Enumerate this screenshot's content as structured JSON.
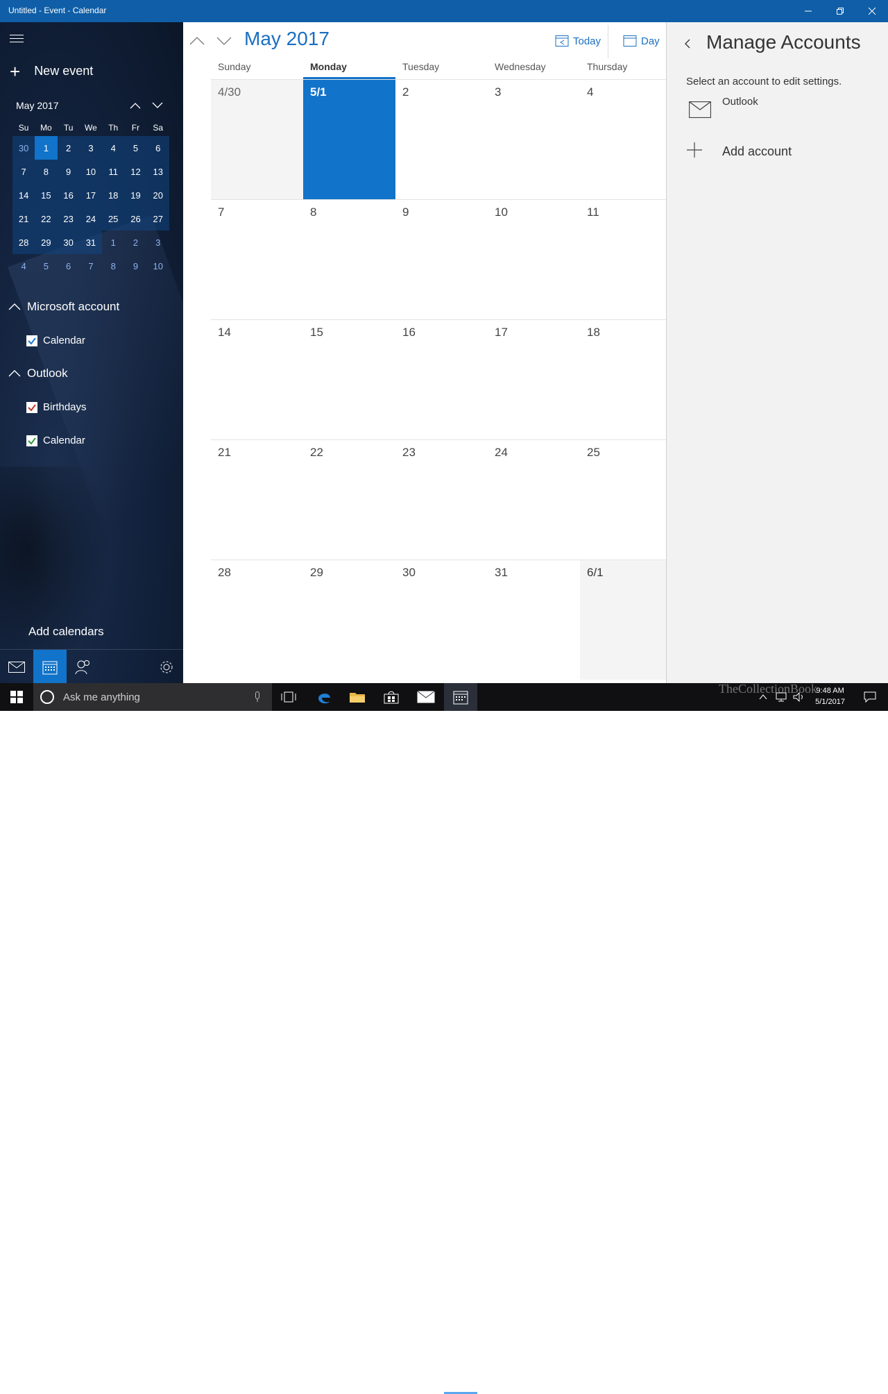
{
  "window": {
    "title": "Untitled - Event - Calendar"
  },
  "sidebar": {
    "new_event_label": "New event",
    "mini_cal": {
      "month_label": "May 2017",
      "day_headers": [
        "Su",
        "Mo",
        "Tu",
        "We",
        "Th",
        "Fr",
        "Sa"
      ],
      "weeks": [
        [
          "30",
          "1",
          "2",
          "3",
          "4",
          "5",
          "6"
        ],
        [
          "7",
          "8",
          "9",
          "10",
          "11",
          "12",
          "13"
        ],
        [
          "14",
          "15",
          "16",
          "17",
          "18",
          "19",
          "20"
        ],
        [
          "21",
          "22",
          "23",
          "24",
          "25",
          "26",
          "27"
        ],
        [
          "28",
          "29",
          "30",
          "31",
          "1",
          "2",
          "3"
        ],
        [
          "4",
          "5",
          "6",
          "7",
          "8",
          "9",
          "10"
        ]
      ]
    },
    "accounts": [
      {
        "name": "Microsoft account",
        "calendars": [
          {
            "name": "Calendar",
            "color": "#1a78d4"
          }
        ]
      },
      {
        "name": "Outlook",
        "calendars": [
          {
            "name": "Birthdays",
            "color": "#c8362b"
          },
          {
            "name": "Calendar",
            "color": "#2e9b3c"
          }
        ]
      }
    ],
    "add_calendars_label": "Add calendars"
  },
  "main": {
    "month_title": "May 2017",
    "today_label": "Today",
    "day_view_label": "Day",
    "day_headers": [
      "Sunday",
      "Monday",
      "Tuesday",
      "Wednesday",
      "Thursday"
    ],
    "weeks": [
      [
        "4/30",
        "5/1",
        "2",
        "3",
        "4"
      ],
      [
        "7",
        "8",
        "9",
        "10",
        "11"
      ],
      [
        "14",
        "15",
        "16",
        "17",
        "18"
      ],
      [
        "21",
        "22",
        "23",
        "24",
        "25"
      ],
      [
        "28",
        "29",
        "30",
        "31",
        "6/1"
      ]
    ]
  },
  "manage_accounts": {
    "title": "Manage Accounts",
    "subtitle": "Select an account to edit settings.",
    "account_name": "Outlook",
    "add_account_label": "Add account"
  },
  "taskbar": {
    "search_placeholder": "Ask me anything",
    "time": "9:48 AM",
    "date": "5/1/2017",
    "watermark": "TheCollectionBook"
  },
  "colors": {
    "accent": "#1173c9",
    "title_bar": "#0f5ea7"
  }
}
